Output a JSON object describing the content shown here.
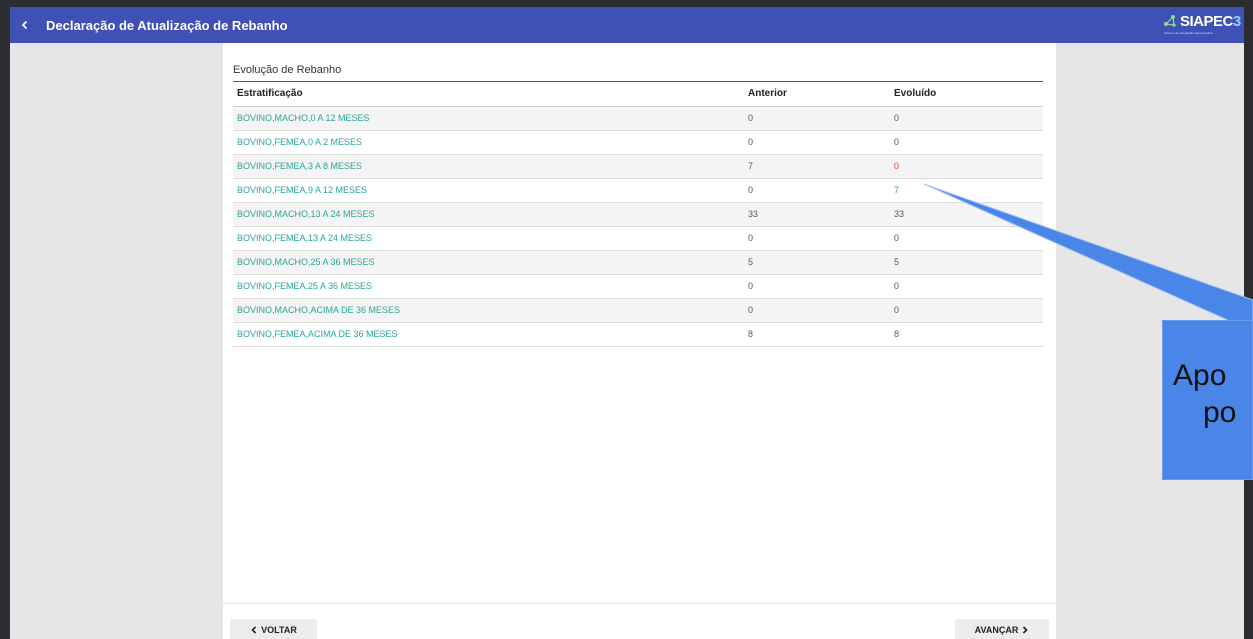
{
  "appbar": {
    "title": "Declaração de Atualização de Rebanho",
    "back_icon": "chevron-left-icon",
    "logo_name": "SIAPEC",
    "logo_number": "3",
    "logo_subtitle": "Sistema de Integração Agropecuária"
  },
  "section": {
    "title": "Evolução de Rebanho"
  },
  "table": {
    "headers": [
      "Estratificação",
      "Anterior",
      "Evoluído"
    ],
    "rows": [
      {
        "strat": "BOVINO,MACHO,0 A 12 MESES",
        "anterior": "0",
        "evoluido": "0"
      },
      {
        "strat": "BOVINO,FEMEA,0 A 2 MESES",
        "anterior": "0",
        "evoluido": "0"
      },
      {
        "strat": "BOVINO,FEMEA,3 A 8 MESES",
        "anterior": "7",
        "evoluido": "0"
      },
      {
        "strat": "BOVINO,FEMEA,9 A 12 MESES",
        "anterior": "0",
        "evoluido": "7"
      },
      {
        "strat": "BOVINO,MACHO,13 A 24 MESES",
        "anterior": "33",
        "evoluido": "33"
      },
      {
        "strat": "BOVINO,FEMEA,13 A 24 MESES",
        "anterior": "0",
        "evoluido": "0"
      },
      {
        "strat": "BOVINO,MACHO,25 A 36 MESES",
        "anterior": "5",
        "evoluido": "5"
      },
      {
        "strat": "BOVINO,FEMEA,25 A 36 MESES",
        "anterior": "0",
        "evoluido": "0"
      },
      {
        "strat": "BOVINO,MACHO,ACIMA DE 36 MESES",
        "anterior": "0",
        "evoluido": "0"
      },
      {
        "strat": "BOVINO,FEMEA,ACIMA DE 36 MESES",
        "anterior": "8",
        "evoluido": "8"
      }
    ]
  },
  "footer": {
    "voltar_label": "VOLTAR",
    "avancar_label": "AVANÇAR"
  },
  "callout": {
    "line1": "Apo",
    "line2": "po"
  },
  "colors": {
    "appbar": "#3f51b5",
    "strat_text": "#26a69a",
    "decreased": "#e53935",
    "increased": "#43a047",
    "callout": "#4a86e8"
  }
}
